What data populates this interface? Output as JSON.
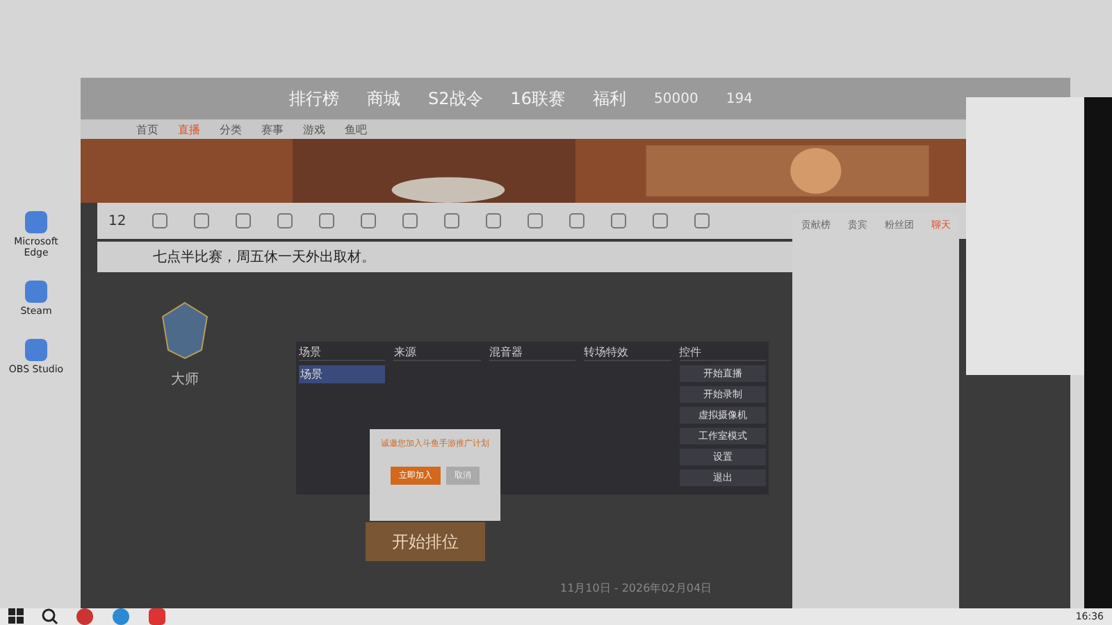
{
  "desktop_icons": [
    {
      "label": "Microsoft Edge"
    },
    {
      "label": "Steam"
    },
    {
      "label": "OBS Studio"
    }
  ],
  "game_header": {
    "nav": [
      "排行榜",
      "商城",
      "S2战令",
      "16联赛",
      "福利"
    ],
    "coins": "50000",
    "gold": "194"
  },
  "site_nav": [
    {
      "label": "首页",
      "selected": false
    },
    {
      "label": "直播",
      "selected": true
    },
    {
      "label": "分类",
      "selected": false
    },
    {
      "label": "赛事",
      "selected": false
    },
    {
      "label": "游戏",
      "selected": false
    },
    {
      "label": "鱼吧",
      "selected": false
    }
  ],
  "stream": {
    "title": "七点半比赛，周五休一天外出取材。",
    "follow_count": "12"
  },
  "rank": {
    "name": "大师"
  },
  "obs": {
    "panels": [
      "场景",
      "来源",
      "混音器",
      "转场特效",
      "控件"
    ],
    "scene": "场景",
    "controls": [
      "开始直播",
      "开始录制",
      "虚拟摄像机",
      "工作室模式",
      "设置",
      "退出"
    ]
  },
  "match": {
    "button": "开始排位",
    "notice": "11月10日 - 2026年02月04日"
  },
  "dialog": {
    "title": "诚邀您加入斗鱼手游推广计划",
    "confirm": "立即加入",
    "cancel": "取消"
  },
  "chat": {
    "tabs": [
      {
        "label": "贡献榜",
        "selected": false
      },
      {
        "label": "贵宾",
        "selected": false
      },
      {
        "label": "粉丝团",
        "selected": false
      },
      {
        "label": "聊天",
        "selected": true
      }
    ]
  },
  "taskbar": {
    "time": "16:36"
  }
}
